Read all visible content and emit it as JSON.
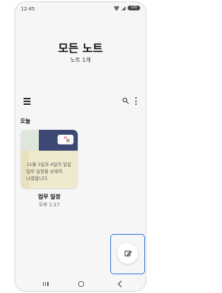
{
  "status_bar": {
    "time": "12:45",
    "battery": "100"
  },
  "header": {
    "title": "모든 노트",
    "subtitle": "노트 1개"
  },
  "toolbar": {
    "menu_icon": "menu-icon",
    "search_icon": "search-icon",
    "more_icon": "more-vertical-icon"
  },
  "section": {
    "label": "오늘"
  },
  "notes": [
    {
      "preview_text": "12월 3일과 4일의 일일\n업무 일정을 상세히\n나열합니다.",
      "title": "업무 일정",
      "time": "오후 1:17",
      "accent_color": "#3c4974",
      "thumb_icon": "calendar-icon"
    }
  ],
  "fab": {
    "icon": "compose-icon",
    "highlight_color": "#2d6fd6"
  },
  "navigation": {
    "recents_icon": "recents-icon",
    "home_icon": "home-icon",
    "back_icon": "back-icon"
  }
}
